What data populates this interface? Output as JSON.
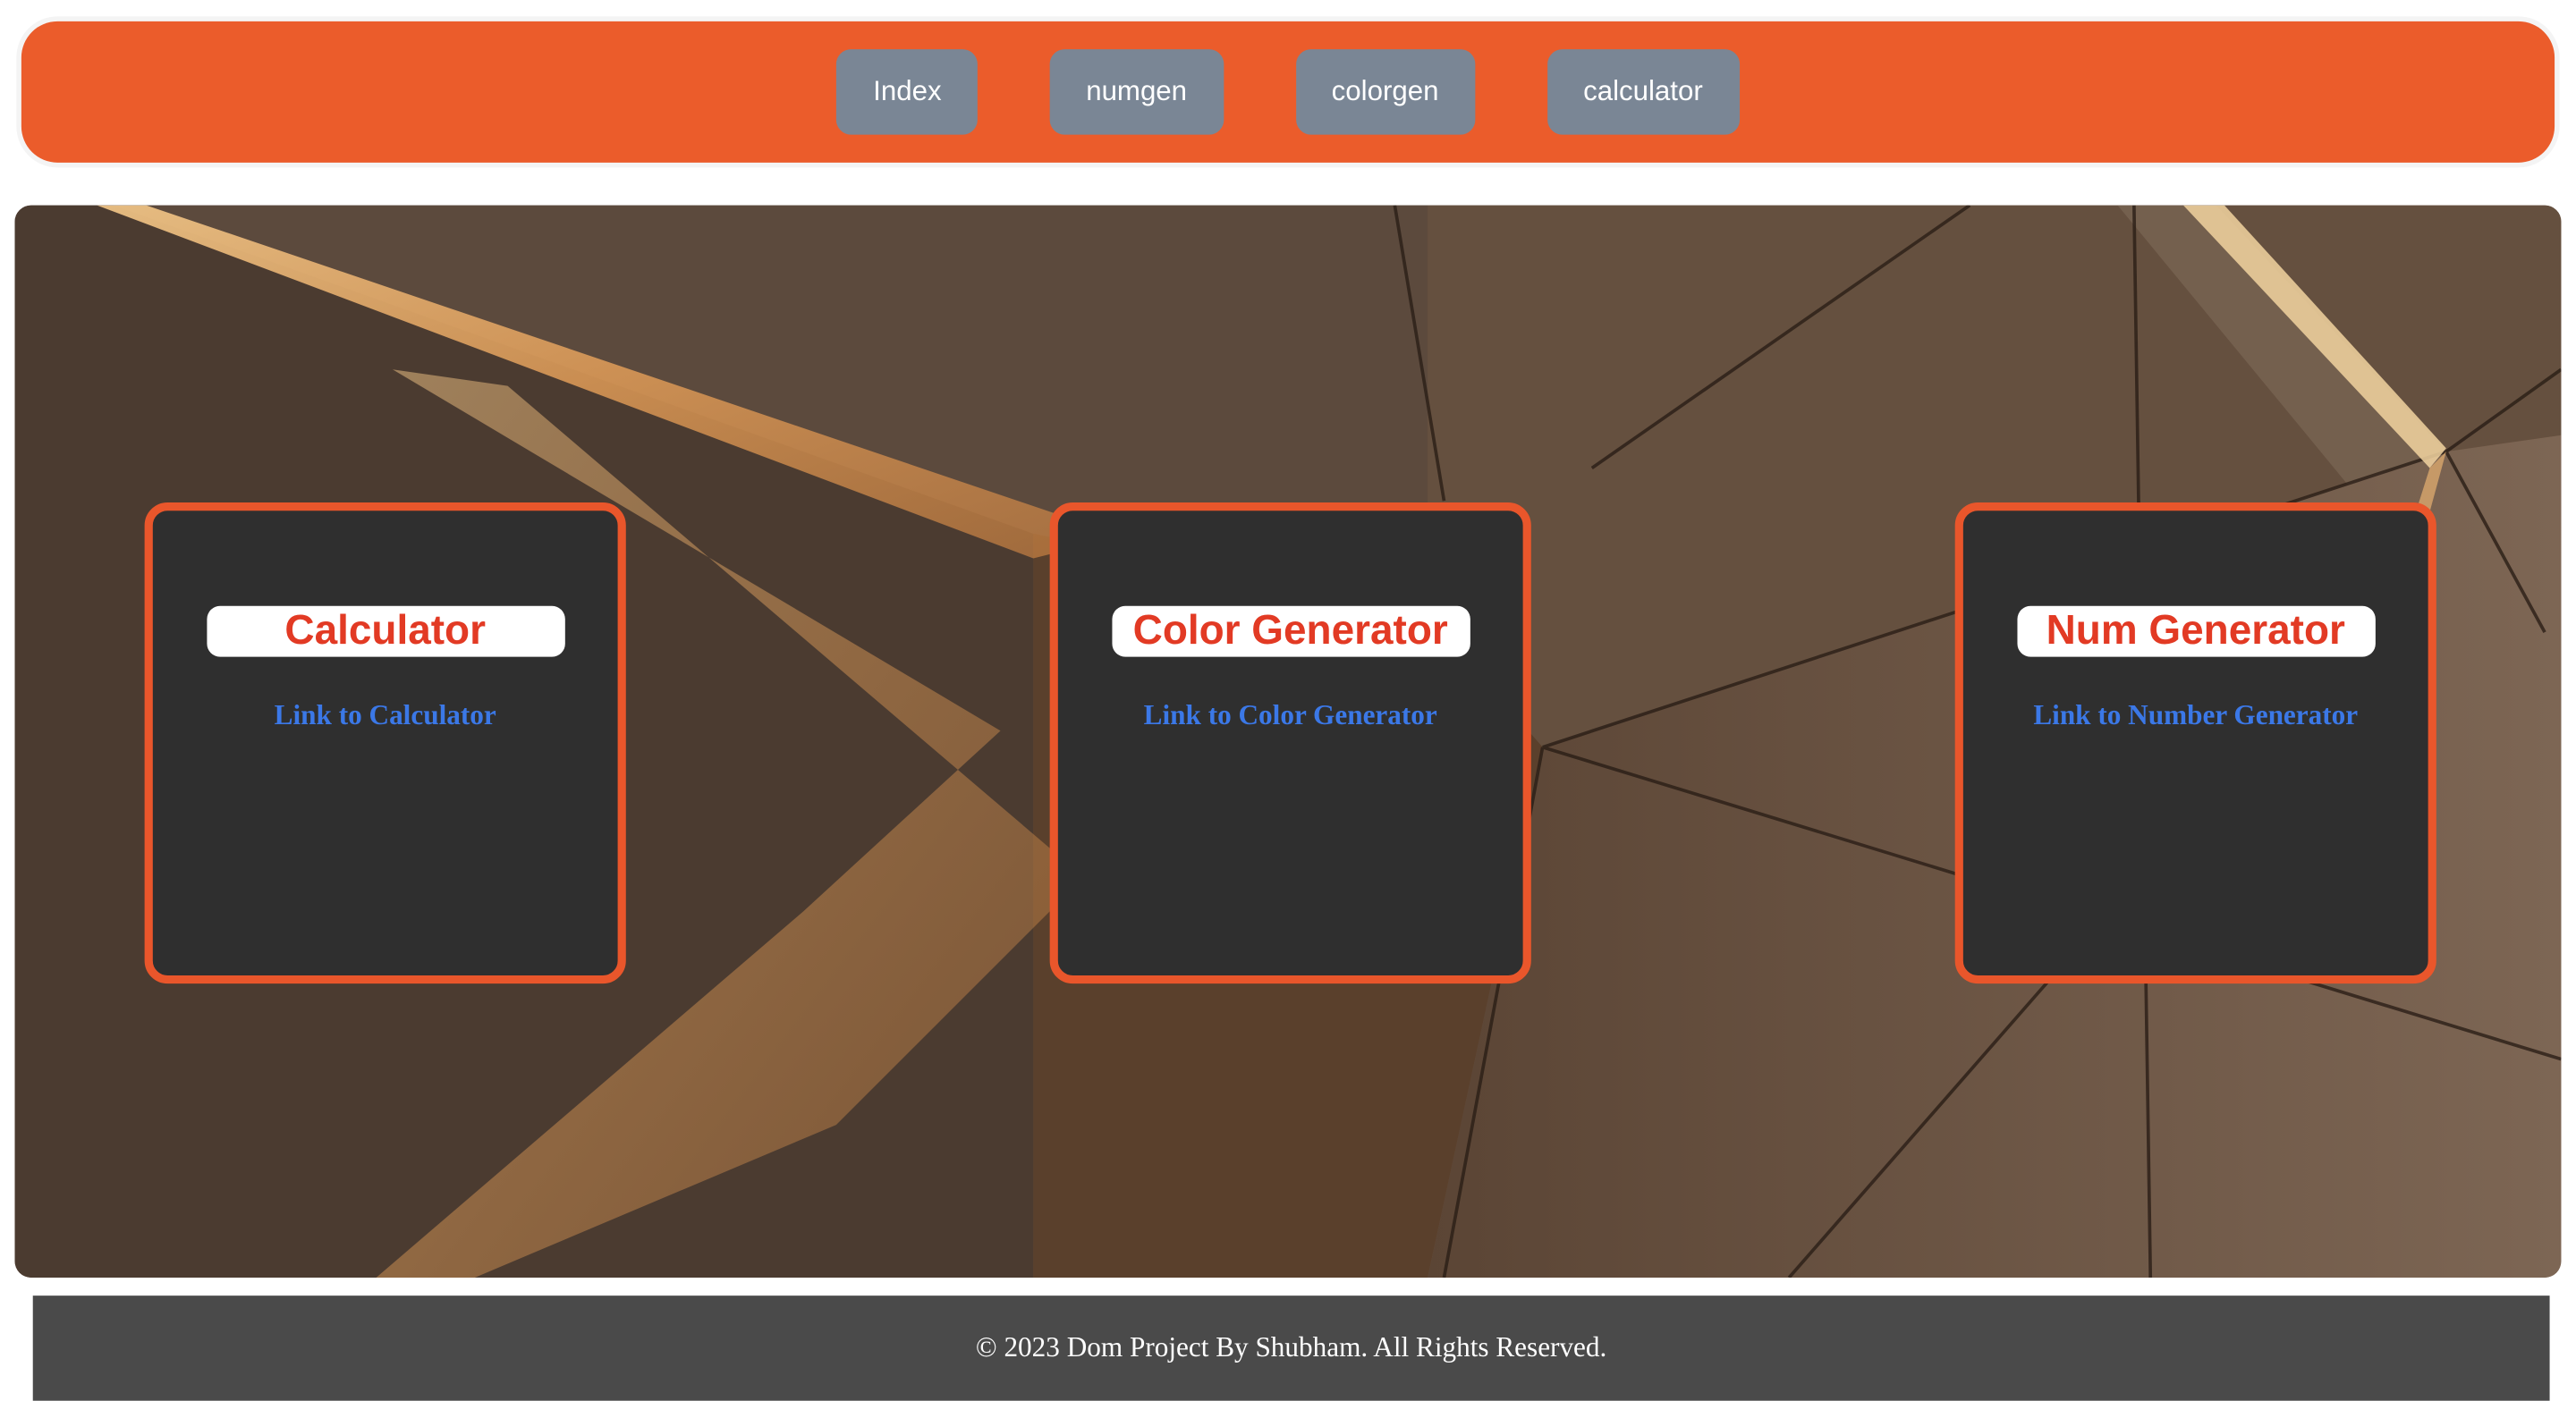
{
  "navbar": {
    "items": [
      {
        "label": "Index"
      },
      {
        "label": "numgen"
      },
      {
        "label": "colorgen"
      },
      {
        "label": "calculator"
      }
    ]
  },
  "cards": [
    {
      "title": "Calculator",
      "link": "Link to Calculator"
    },
    {
      "title": "Color Generator",
      "link": "Link to Color Generator"
    },
    {
      "title": "Num Generator",
      "link": "Link to Number Generator"
    }
  ],
  "footer": {
    "text": "© 2023 Dom Project By Shubham. All Rights Reserved."
  },
  "colors": {
    "accent": "#eb5c2b",
    "nav_button": "#7a8695",
    "card_bg": "#2f2f2f",
    "card_title": "#e23a24",
    "link": "#3b78e7",
    "footer_bg": "#4a4a4a"
  }
}
